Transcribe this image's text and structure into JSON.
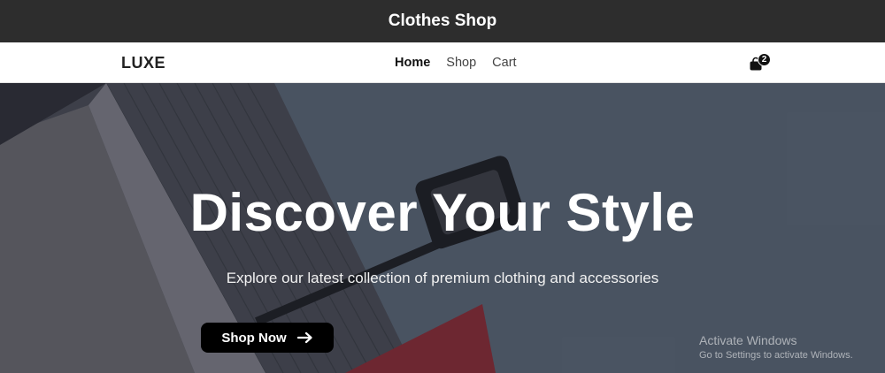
{
  "window": {
    "title": "Clothes Shop"
  },
  "navbar": {
    "logo": "LUXE",
    "links": [
      {
        "label": "Home",
        "active": true
      },
      {
        "label": "Shop",
        "active": false
      },
      {
        "label": "Cart",
        "active": false
      }
    ],
    "cart": {
      "icon": "shopping-bag-icon",
      "count": "2"
    }
  },
  "hero": {
    "title": "Discover Your Style",
    "subtitle": "Explore our latest collection of premium clothing and accessories",
    "cta_label": "Shop Now",
    "cta_icon": "arrow-right-icon"
  },
  "watermark": {
    "line1": "Activate Windows",
    "line2": "Go to Settings to activate Windows."
  }
}
